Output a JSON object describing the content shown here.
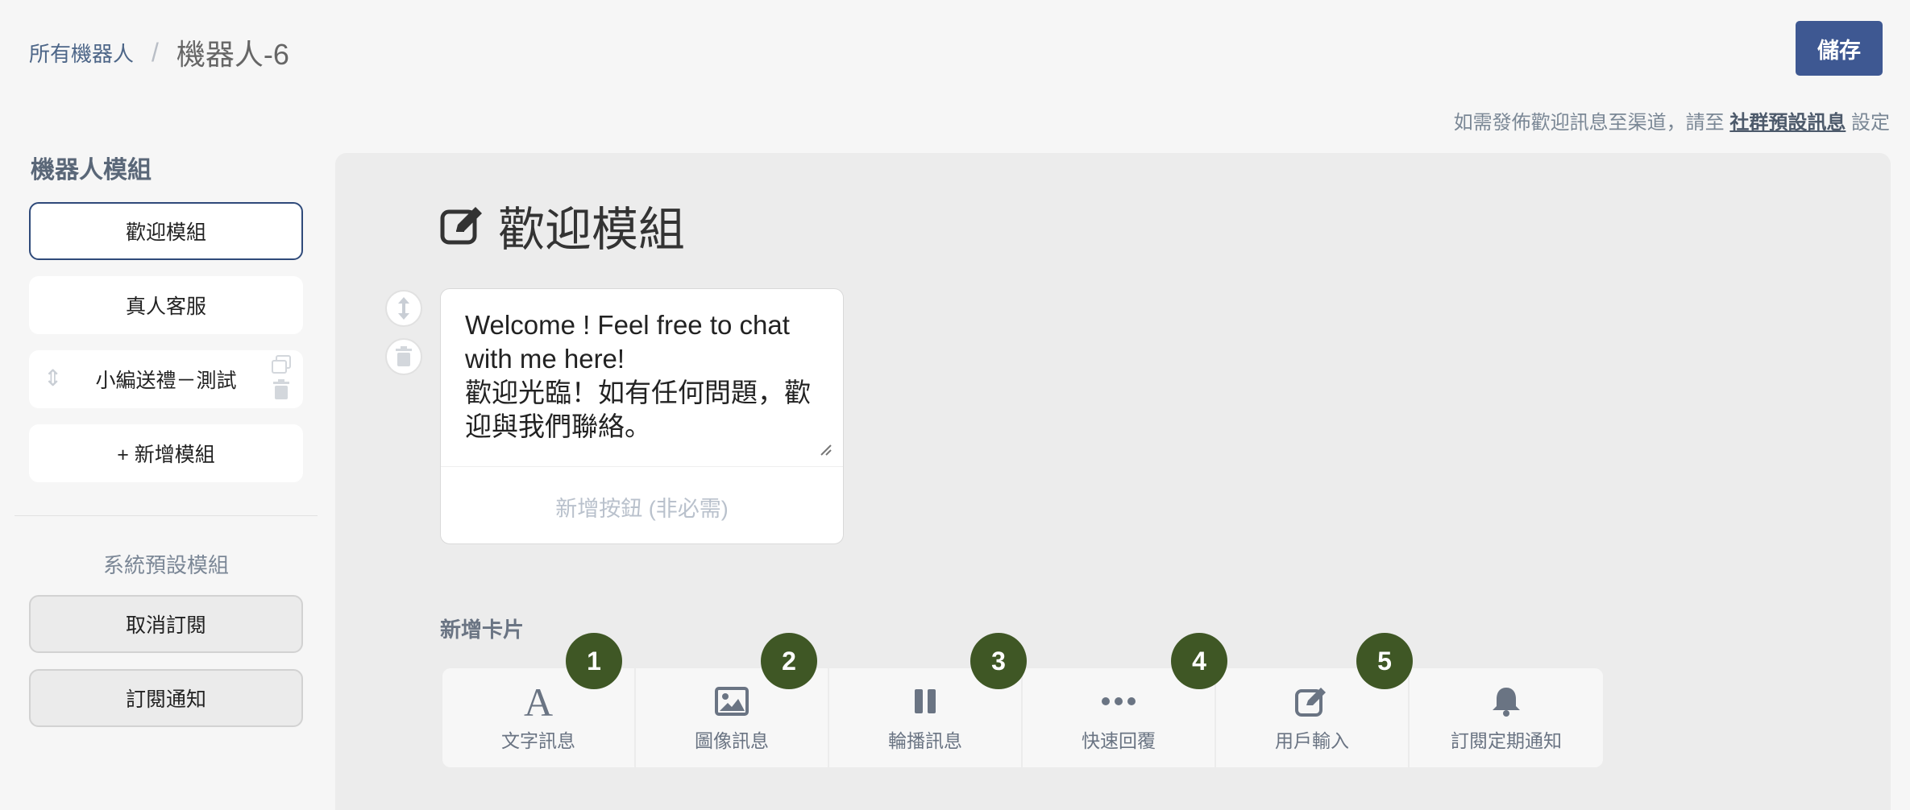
{
  "breadcrumb": {
    "parent": "所有機器人",
    "separator": "/",
    "current": "機器人-6"
  },
  "save_label": "儲存",
  "hint": {
    "prefix": "如需發佈歡迎訊息至渠道，請至 ",
    "link": "社群預設訊息",
    "suffix": " 設定"
  },
  "sidebar": {
    "title": "機器人模組",
    "modules": [
      {
        "label": "歡迎模組",
        "active": true
      },
      {
        "label": "真人客服"
      },
      {
        "label": "小編送禮－測試"
      },
      {
        "label": "+ 新增模組"
      }
    ],
    "system_title": "系統預設模組",
    "system_modules": [
      {
        "label": "取消訂閱"
      },
      {
        "label": "訂閱通知"
      }
    ]
  },
  "main": {
    "title": "歡迎模組",
    "message_text": "Welcome ! Feel free to chat with me here!\n歡迎光臨！如有任何問題，歡迎與我們聯絡。",
    "add_button_label": "新增按鈕 (非必需)",
    "add_card_label": "新增卡片",
    "card_types": [
      {
        "label": "文字訊息",
        "icon": "text-icon"
      },
      {
        "label": "圖像訊息",
        "icon": "image-icon"
      },
      {
        "label": "輪播訊息",
        "icon": "carousel-icon"
      },
      {
        "label": "快速回覆",
        "icon": "ellipsis-icon"
      },
      {
        "label": "用戶輸入",
        "icon": "edit-icon"
      },
      {
        "label": "訂閱定期通知",
        "icon": "bell-icon"
      }
    ],
    "badges": [
      "1",
      "2",
      "3",
      "4",
      "5"
    ]
  },
  "colors": {
    "primary": "#3e5892",
    "badge": "#3f5725",
    "active_border": "#2f4a7a"
  }
}
